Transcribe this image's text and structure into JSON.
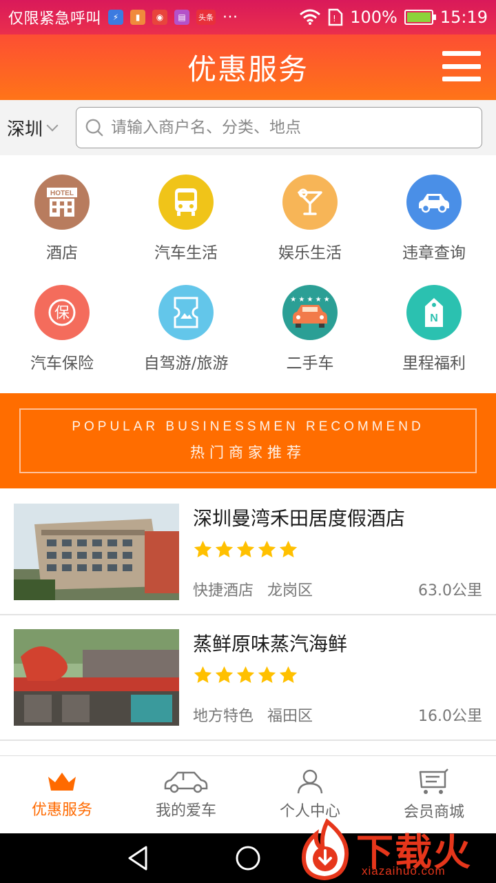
{
  "status_bar": {
    "carrier": "仅限紧急呼叫",
    "news_badge": "头条",
    "more": "···",
    "battery_pct": "100%",
    "time": "15:19"
  },
  "header": {
    "title": "优惠服务"
  },
  "search": {
    "city": "深圳",
    "placeholder": "请输入商户名、分类、地点"
  },
  "categories": [
    {
      "label": "酒店",
      "icon": "hotel-icon",
      "color": "#b87c5e",
      "badge": "HOTEL"
    },
    {
      "label": "汽车生活",
      "icon": "bus-icon",
      "color": "#f0c419"
    },
    {
      "label": "娱乐生活",
      "icon": "cocktail-icon",
      "color": "#f7b557"
    },
    {
      "label": "违章查询",
      "icon": "car-icon",
      "color": "#4a8fe7"
    },
    {
      "label": "汽车保险",
      "icon": "insurance-icon",
      "color": "#f46c5c",
      "badge": "保"
    },
    {
      "label": "自驾游/旅游",
      "icon": "ticket-icon",
      "color": "#63c6ea"
    },
    {
      "label": "二手车",
      "icon": "used-car-icon",
      "color": "#2b9f95"
    },
    {
      "label": "里程福利",
      "icon": "tag-icon",
      "color": "#2bc1b0",
      "badge": "N"
    }
  ],
  "banner": {
    "english": "POPULAR BUSINESSMEN RECOMMEND",
    "chinese": "热门商家推荐"
  },
  "listings": [
    {
      "name": "深圳曼湾禾田居度假酒店",
      "stars": 5,
      "category": "快捷酒店",
      "district": "龙岗区",
      "distance": "63.0公里"
    },
    {
      "name": "蒸鲜原味蒸汽海鲜",
      "stars": 5,
      "category": "地方特色",
      "district": "福田区",
      "distance": "16.0公里"
    }
  ],
  "tabs": [
    {
      "label": "优惠服务",
      "icon": "crown-icon",
      "active": true
    },
    {
      "label": "我的爱车",
      "icon": "car-outline-icon",
      "active": false
    },
    {
      "label": "个人中心",
      "icon": "person-icon",
      "active": false
    },
    {
      "label": "会员商城",
      "icon": "cart-icon",
      "active": false
    }
  ],
  "watermark": {
    "brand": "下载火",
    "url": "xiazaihuo.com"
  },
  "colors": {
    "accent": "#ff6a00",
    "star": "#ffc000"
  }
}
